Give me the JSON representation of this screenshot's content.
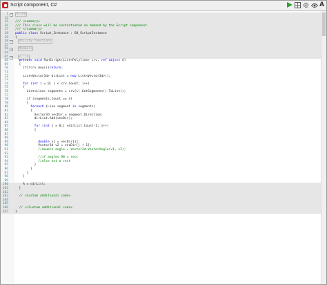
{
  "window": {
    "title": "Script component, C#"
  },
  "toolbar": {
    "run_icon": "play-icon",
    "icons": [
      "grid-icon",
      "gear-icon",
      "eye-icon",
      "font-icon",
      "menu-icon"
    ],
    "font_glyph": "A"
  },
  "editor": {
    "lines": [
      {
        "n": "1",
        "t": "Using",
        "k": "region",
        "f": true
      },
      {
        "n": "14",
        "t": "",
        "k": "plain"
      },
      {
        "n": "15",
        "t": "/// <summary>",
        "k": "comment"
      },
      {
        "n": "16",
        "t": "/// This class will be instantiated on demand by the Script component.",
        "k": "comment"
      },
      {
        "n": "17",
        "t": "/// </summary>",
        "k": "comment"
      },
      {
        "n": "18",
        "t": "public class Script_Instance : GH_ScriptInstance",
        "k": "plain"
      },
      {
        "n": "19",
        "t": "{",
        "k": "plain"
      },
      {
        "n": "20",
        "t": "Utility functions",
        "k": "region",
        "f": true,
        "i": 1
      },
      {
        "n": "55",
        "t": "",
        "k": "plain"
      },
      {
        "n": "56",
        "t": "Members",
        "k": "region",
        "f": true,
        "i": 1
      },
      {
        "n": "64",
        "t": "",
        "k": "plain"
      },
      {
        "n": "65",
        "t": "<...>",
        "k": "region",
        "f": true,
        "i": 1
      },
      {
        "n": "68",
        "t": "  private void RunScript(List<Polyline> crv, ref object A)",
        "k": "plain"
      },
      {
        "n": "69",
        "t": "  {",
        "k": "plain"
      },
      {
        "n": "70",
        "t": "    if(!crv.Any())return;",
        "k": "plain"
      },
      {
        "n": "71",
        "t": "",
        "k": "plain"
      },
      {
        "n": "72",
        "t": "    List<Vector3d> dirList = new List<Vector3d>();",
        "k": "plain"
      },
      {
        "n": "73",
        "t": "",
        "k": "plain"
      },
      {
        "n": "74",
        "t": "    for (int i = 0; i < crv.Count; i++)",
        "k": "plain"
      },
      {
        "n": "75",
        "t": "    {",
        "k": "plain"
      },
      {
        "n": "76",
        "t": "      List<Line> segments = crv[i].GetSegments().ToList();",
        "k": "plain"
      },
      {
        "n": "77",
        "t": "",
        "k": "plain"
      },
      {
        "n": "78",
        "t": "      if (segments.Count == 4)",
        "k": "plain"
      },
      {
        "n": "79",
        "t": "      {",
        "k": "plain"
      },
      {
        "n": "80",
        "t": "        foreach (Line segment in segments)",
        "k": "plain"
      },
      {
        "n": "81",
        "t": "        {",
        "k": "plain"
      },
      {
        "n": "82",
        "t": "          Vector3d vecDir = segment.Direction;",
        "k": "plain"
      },
      {
        "n": "83",
        "t": "          dirList.Add(vecDir);",
        "k": "plain"
      },
      {
        "n": "84",
        "t": "",
        "k": "plain"
      },
      {
        "n": "85",
        "t": "          for (int j = 0;j <dirList.Count-1; j++)",
        "k": "plain"
      },
      {
        "n": "86",
        "t": "          {",
        "k": "plain"
      },
      {
        "n": "87",
        "t": "",
        "k": "plain"
      },
      {
        "n": "88",
        "t": "",
        "k": "plain"
      },
      {
        "n": "89",
        "t": "            double v1 = vecDir[j];",
        "k": "plain"
      },
      {
        "n": "90",
        "t": "            Vector3d v2 = vecDir[j + 1];",
        "k": "plain"
      },
      {
        "n": "91",
        "t": "            //double angle = Vector3d.VectorAngle(v1, v2);",
        "k": "comment"
      },
      {
        "n": "92",
        "t": "",
        "k": "plain"
      },
      {
        "n": "93",
        "t": "            //if angles 90 = rect",
        "k": "comment"
      },
      {
        "n": "94",
        "t": "            //else not a rect",
        "k": "comment"
      },
      {
        "n": "95",
        "t": "          }",
        "k": "plain"
      },
      {
        "n": "96",
        "t": "        }",
        "k": "plain"
      },
      {
        "n": "97",
        "t": "      }",
        "k": "plain"
      },
      {
        "n": "98",
        "t": "    }",
        "k": "plain"
      },
      {
        "n": "99",
        "t": "",
        "k": "plain"
      },
      {
        "n": "100",
        "t": "    A = dirList;",
        "k": "plain"
      },
      {
        "n": "101",
        "t": "  }",
        "k": "plain"
      },
      {
        "n": "102",
        "t": "",
        "k": "plain"
      },
      {
        "n": "103",
        "t": "  // <Custom additional code>",
        "k": "comment"
      },
      {
        "n": "104",
        "t": "",
        "k": "plain"
      },
      {
        "n": "105",
        "t": "",
        "k": "plain"
      },
      {
        "n": "106",
        "t": "  // </Custom additional code>",
        "k": "comment"
      },
      {
        "n": "107",
        "t": "}",
        "k": "plain"
      }
    ]
  }
}
